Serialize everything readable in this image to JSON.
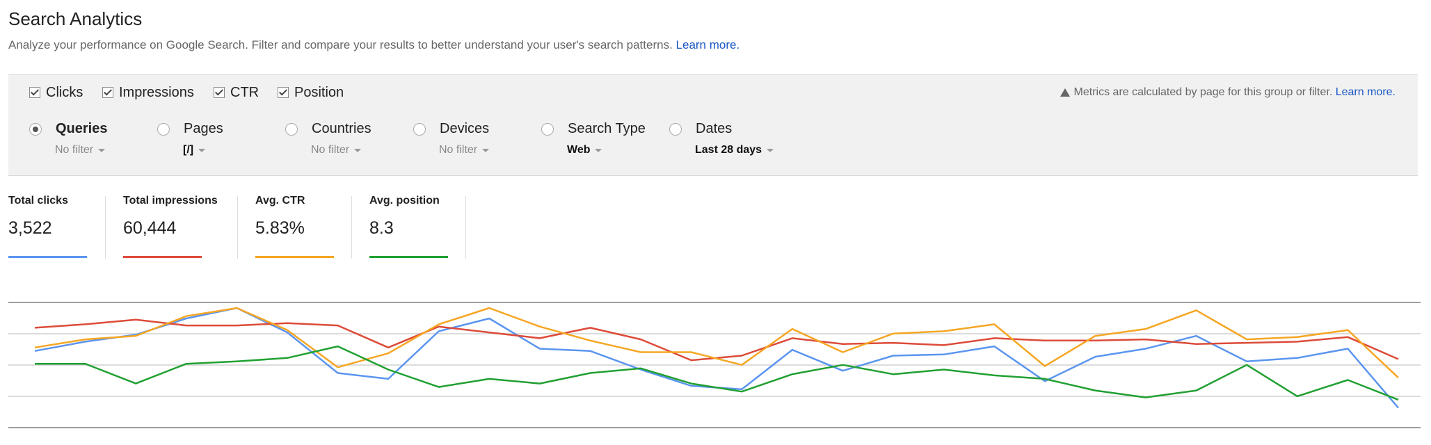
{
  "header": {
    "title": "Search Analytics",
    "subtitle": "Analyze your performance on Google Search. Filter and compare your results to better understand your user's search patterns.",
    "learn_more": "Learn more."
  },
  "metrics": {
    "items": [
      {
        "label": "Clicks",
        "checked": true
      },
      {
        "label": "Impressions",
        "checked": true
      },
      {
        "label": "CTR",
        "checked": true
      },
      {
        "label": "Position",
        "checked": true
      }
    ],
    "notice": "Metrics are calculated by page for this group or filter.",
    "notice_link": "Learn more.",
    "notice_icon": "warning-icon"
  },
  "groups": [
    {
      "label": "Queries",
      "filter": "No filter",
      "selected": true
    },
    {
      "label": "Pages",
      "filter": "[/]",
      "selected": false
    },
    {
      "label": "Countries",
      "filter": "No filter",
      "selected": false
    },
    {
      "label": "Devices",
      "filter": "No filter",
      "selected": false
    },
    {
      "label": "Search Type",
      "filter": "Web",
      "selected": false
    },
    {
      "label": "Dates",
      "filter": "Last 28 days",
      "selected": false
    }
  ],
  "totals": [
    {
      "label": "Total clicks",
      "value": "3,522",
      "color": "#5b95ef"
    },
    {
      "label": "Total impressions",
      "value": "60,444",
      "color": "#dd4b39"
    },
    {
      "label": "Avg. CTR",
      "value": "5.83%",
      "color": "#f5a623"
    },
    {
      "label": "Avg. position",
      "value": "8.3",
      "color": "#21a032"
    }
  ],
  "chart_data": {
    "type": "line",
    "x": [
      1,
      2,
      3,
      4,
      5,
      6,
      7,
      8,
      9,
      10,
      11,
      12,
      13,
      14,
      15,
      16,
      17,
      18,
      19,
      20,
      21,
      22,
      23,
      24,
      25,
      26,
      27,
      28
    ],
    "series": [
      {
        "name": "Clicks",
        "color": "#5b95ef",
        "values": [
          0.63,
          0.71,
          0.77,
          0.91,
          1.0,
          0.79,
          0.44,
          0.39,
          0.8,
          0.91,
          0.65,
          0.63,
          0.47,
          0.33,
          0.3,
          0.64,
          0.46,
          0.59,
          0.6,
          0.67,
          0.37,
          0.58,
          0.65,
          0.76,
          0.54,
          0.57,
          0.65,
          0.14
        ]
      },
      {
        "name": "Impressions",
        "color": "#dd4b39",
        "values": [
          0.83,
          0.86,
          0.9,
          0.85,
          0.85,
          0.87,
          0.85,
          0.66,
          0.84,
          0.79,
          0.74,
          0.83,
          0.73,
          0.55,
          0.59,
          0.74,
          0.69,
          0.7,
          0.68,
          0.74,
          0.72,
          0.72,
          0.73,
          0.69,
          0.7,
          0.71,
          0.75,
          0.56
        ]
      },
      {
        "name": "CTR",
        "color": "#f5a623",
        "values": [
          0.66,
          0.73,
          0.76,
          0.93,
          1.0,
          0.81,
          0.49,
          0.61,
          0.86,
          1.0,
          0.84,
          0.72,
          0.62,
          0.62,
          0.51,
          0.82,
          0.62,
          0.78,
          0.8,
          0.86,
          0.5,
          0.76,
          0.82,
          0.98,
          0.73,
          0.75,
          0.81,
          0.4
        ]
      },
      {
        "name": "Position",
        "color": "#21a032",
        "values": [
          0.52,
          0.52,
          0.35,
          0.52,
          0.54,
          0.57,
          0.67,
          0.47,
          0.32,
          0.39,
          0.35,
          0.44,
          0.48,
          0.35,
          0.28,
          0.43,
          0.51,
          0.43,
          0.47,
          0.42,
          0.39,
          0.29,
          0.23,
          0.29,
          0.51,
          0.24,
          0.38,
          0.21
        ]
      }
    ],
    "grid": true,
    "gridlines": 4
  }
}
